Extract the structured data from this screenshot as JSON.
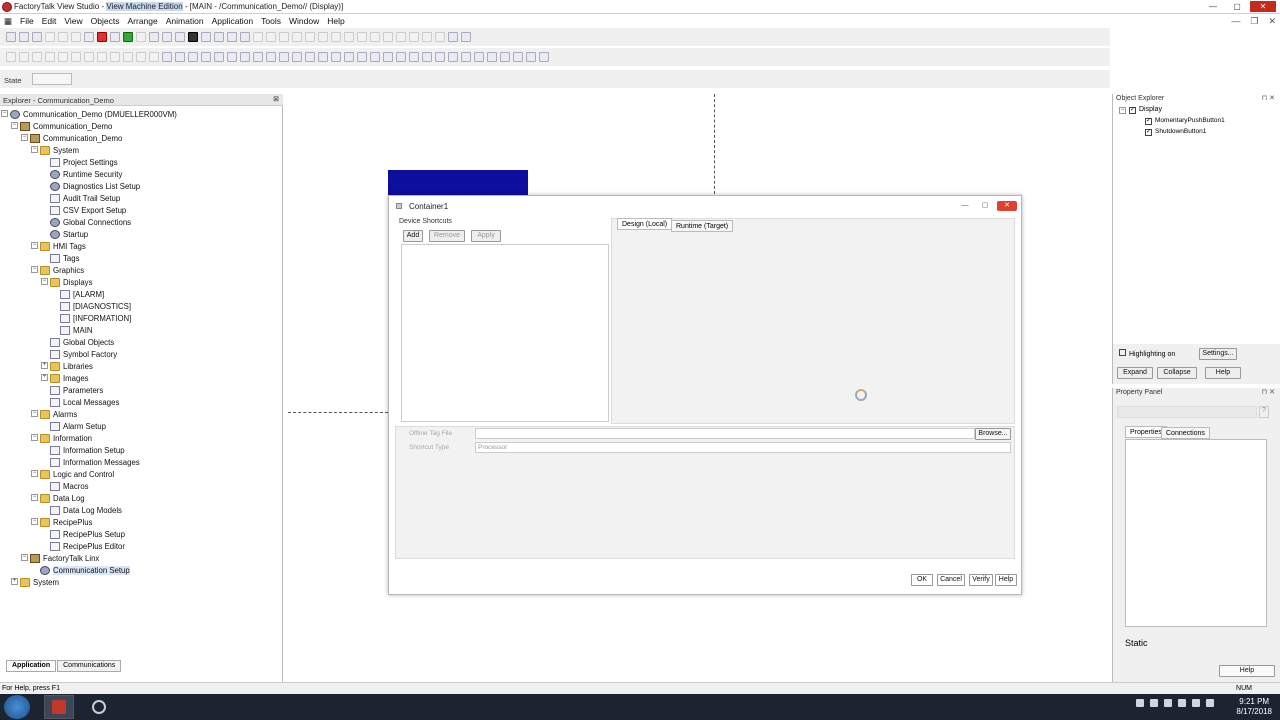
{
  "window": {
    "title_prefix": "FactoryTalk View Studio - ",
    "title_highlight": "View Machine Edition",
    "title_suffix": " - [MAIN - /Communication_Demo// (Display)]"
  },
  "menu": [
    "File",
    "Edit",
    "View",
    "Objects",
    "Arrange",
    "Animation",
    "Application",
    "Tools",
    "Window",
    "Help"
  ],
  "state": {
    "label": "State"
  },
  "explorer": {
    "title": "Explorer - Communication_Demo",
    "root": "Communication_Demo (DMUELLER000VM)",
    "nodes": [
      "Communication_Demo",
      "Communication_Demo",
      "System",
      "Project Settings",
      "Runtime Security",
      "Diagnostics List Setup",
      "Audit Trail Setup",
      "CSV Export Setup",
      "Global Connections",
      "Startup",
      "HMI Tags",
      "Tags",
      "Graphics",
      "Displays",
      "[ALARM]",
      "[DIAGNOSTICS]",
      "[INFORMATION]",
      "MAIN",
      "Global Objects",
      "Symbol Factory",
      "Libraries",
      "Images",
      "Parameters",
      "Local Messages",
      "Alarms",
      "Alarm Setup",
      "Information",
      "Information Setup",
      "Information Messages",
      "Logic and Control",
      "Macros",
      "Data Log",
      "Data Log Models",
      "RecipePlus",
      "RecipePlus Setup",
      "RecipePlus Editor",
      "FactoryTalk Linx",
      "Communication Setup",
      "System"
    ],
    "tabs": [
      "Application",
      "Communications"
    ]
  },
  "dialog": {
    "title": "Container1",
    "shortcuts_group": "Device Shortcuts",
    "add": "Add",
    "remove": "Remove",
    "apply": "Apply",
    "tab_local": "Design (Local)",
    "tab_runtime": "Runtime (Target)",
    "offline_tag_label": "Offline Tag File",
    "browse": "Browse...",
    "shortcut_type_label": "Shortcut Type",
    "shortcut_type_value": "Processor",
    "ok": "OK",
    "cancel": "Cancel",
    "verify": "Verify",
    "help": "Help"
  },
  "object_explorer": {
    "title": "Object Explorer",
    "root": "Display",
    "items": [
      "MomentaryPushButton1",
      "ShutdownButton1"
    ],
    "highlighting": "Highlighting on",
    "settings": "Settings...",
    "expand": "Expand",
    "collapse": "Collapse",
    "help": "Help"
  },
  "property_panel": {
    "title": "Property Panel",
    "tab_properties": "Properties",
    "tab_connections": "Connections",
    "static": "Static",
    "help": "Help"
  },
  "status": {
    "left": "For Help, press F1",
    "right": "NUM"
  },
  "clock": {
    "time": "9:21 PM",
    "date": "8/17/2018"
  }
}
